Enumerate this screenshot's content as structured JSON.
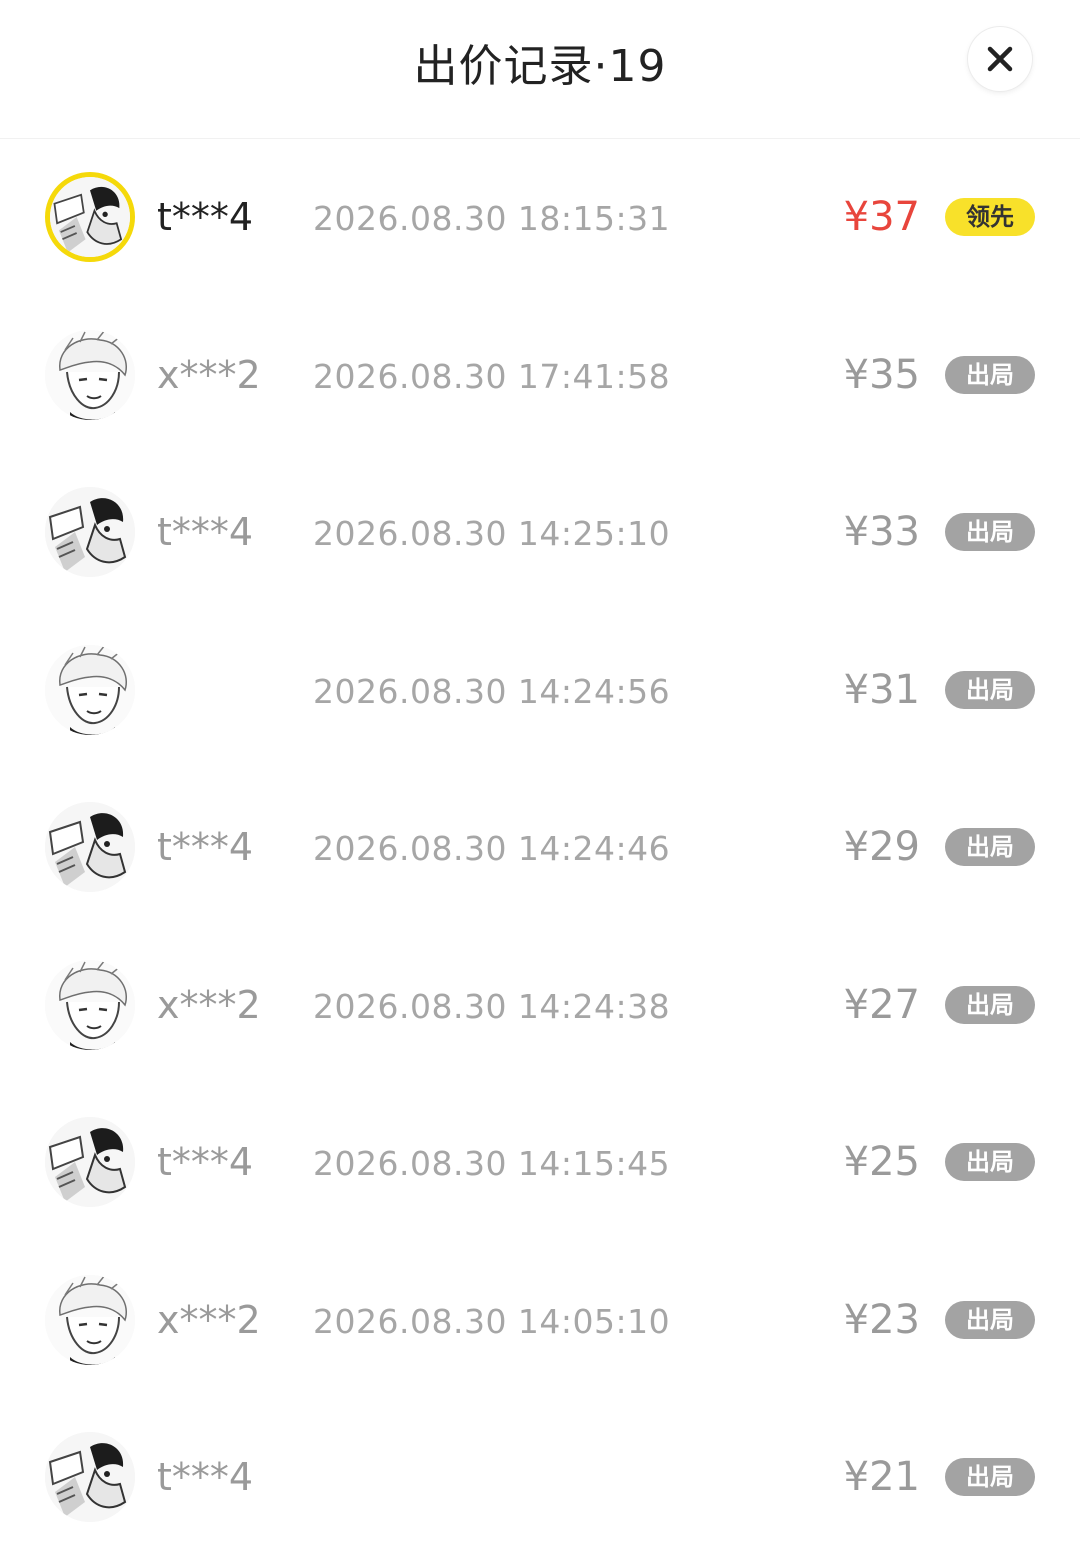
{
  "header": {
    "title": "出价记录·19",
    "close_icon": "close-icon"
  },
  "bids": [
    {
      "user": "t***4",
      "time": "2026.08.30 18:15:31",
      "price": "¥37",
      "status": "领先",
      "leading": true,
      "avatar": "t"
    },
    {
      "user": "x***2",
      "time": "2026.08.30 17:41:58",
      "price": "¥35",
      "status": "出局",
      "leading": false,
      "avatar": "x"
    },
    {
      "user": "t***4",
      "time": "2026.08.30 14:25:10",
      "price": "¥33",
      "status": "出局",
      "leading": false,
      "avatar": "t"
    },
    {
      "user": "",
      "time": "2026.08.30 14:24:56",
      "price": "¥31",
      "status": "出局",
      "leading": false,
      "avatar": "x"
    },
    {
      "user": "t***4",
      "time": "2026.08.30 14:24:46",
      "price": "¥29",
      "status": "出局",
      "leading": false,
      "avatar": "t"
    },
    {
      "user": "x***2",
      "time": "2026.08.30 14:24:38",
      "price": "¥27",
      "status": "出局",
      "leading": false,
      "avatar": "x"
    },
    {
      "user": "t***4",
      "time": "2026.08.30 14:15:45",
      "price": "¥25",
      "status": "出局",
      "leading": false,
      "avatar": "t"
    },
    {
      "user": "x***2",
      "time": "2026.08.30 14:05:10",
      "price": "¥23",
      "status": "出局",
      "leading": false,
      "avatar": "x"
    },
    {
      "user": "t***4",
      "time": "",
      "price": "¥21",
      "status": "出局",
      "leading": false,
      "avatar": "t"
    }
  ],
  "colors": {
    "leading_price": "#e8453c",
    "leading_badge": "#f8e12a",
    "out_badge": "#a3a3a3",
    "muted_text": "#9a9a9a"
  }
}
